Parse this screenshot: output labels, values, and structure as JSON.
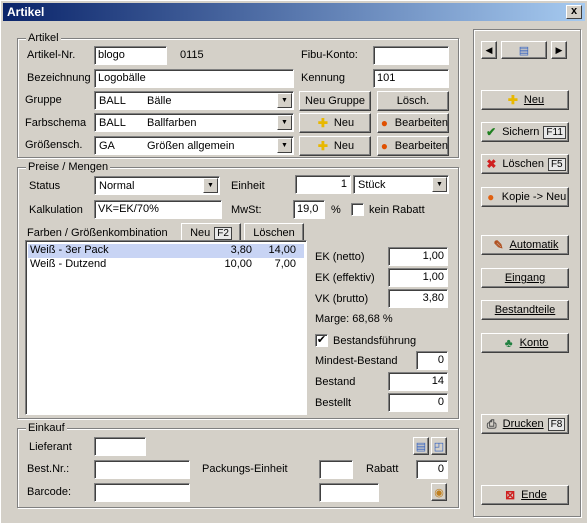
{
  "window": {
    "title": "Artikel",
    "close": "x"
  },
  "artikel": {
    "legend": "Artikel",
    "nr_label": "Artikel-Nr.",
    "nr_value": "blogo",
    "nr_extra": "0115",
    "fibu_label": "Fibu-Konto:",
    "fibu_value": "",
    "bez_label": "Bezeichnung",
    "bez_value": "Logobälle",
    "kennung_label": "Kennung",
    "kennung_value": "101",
    "gruppe_label": "Gruppe",
    "gruppe_code": "BALL",
    "gruppe_name": "Bälle",
    "btn_neu_gruppe": "Neu Gruppe",
    "btn_losch": "Lösch.",
    "farb_label": "Farbschema",
    "farb_code": "BALL",
    "farb_name": "Ballfarben",
    "btn_neu": "Neu",
    "btn_bearbeiten": "Bearbeiten",
    "gross_label": "Größensch.",
    "gross_code": "GA",
    "gross_name": "Größen allgemein"
  },
  "preise": {
    "legend": "Preise / Mengen",
    "status_label": "Status",
    "status_value": "Normal",
    "einheit_label": "Einheit",
    "einheit_qty": "1",
    "einheit_value": "Stück",
    "kalk_label": "Kalkulation",
    "kalk_value": "VK=EK/70%",
    "mwst_label": "MwSt:",
    "mwst_value": "19,0",
    "mwst_unit": "%",
    "kein_rabatt": "kein Rabatt",
    "farben_label": "Farben / Größenkombination",
    "btn_neu": "Neu",
    "btn_neu_key": "F2",
    "btn_loschen": "Löschen",
    "rows": [
      {
        "name": "Weiß - 3er Pack",
        "a": "3,80",
        "b": "14,00"
      },
      {
        "name": "Weiß - Dutzend",
        "a": "10,00",
        "b": "7,00"
      }
    ],
    "ek_netto_label": "EK (netto)",
    "ek_netto": "1,00",
    "ek_eff_label": "EK (effektiv)",
    "ek_eff": "1,00",
    "vk_label": "VK (brutto)",
    "vk": "3,80",
    "marge": "Marge: 68,68 %",
    "bestandsf": "Bestandsführung",
    "mindest_label": "Mindest-Bestand",
    "mindest": "0",
    "bestand_label": "Bestand",
    "bestand": "14",
    "bestellt_label": "Bestellt",
    "bestellt": "0"
  },
  "einkauf": {
    "legend": "Einkauf",
    "lieferant_label": "Lieferant",
    "lieferant": "",
    "bestnr_label": "Best.Nr.:",
    "bestnr": "",
    "pack_label": "Packungs-Einheit",
    "pack": "",
    "rabatt_label": "Rabatt",
    "rabatt": "0",
    "barcode_label": "Barcode:",
    "barcode": "",
    "barcode2": ""
  },
  "side": {
    "neu": "Neu",
    "sichern": "Sichern",
    "sichern_key": "F11",
    "loschen": "Löschen",
    "loschen_key": "F5",
    "kopie": "Kopie -> Neu",
    "automatik": "Automatik",
    "eingang": "Eingang",
    "bestandteile": "Bestandteile",
    "konto": "Konto",
    "drucken": "Drucken",
    "drucken_key": "F8",
    "ende": "Ende"
  }
}
